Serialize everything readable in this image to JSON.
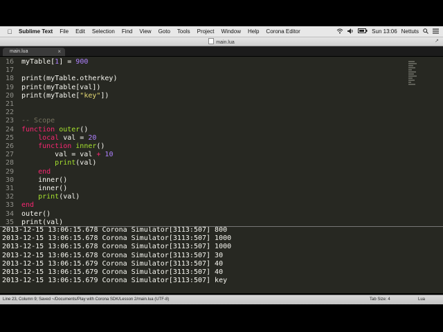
{
  "menubar": {
    "items": [
      "Sublime Text",
      "File",
      "Edit",
      "Selection",
      "Find",
      "View",
      "Goto",
      "Tools",
      "Project",
      "Window",
      "Help",
      "Corona Editor"
    ],
    "clock": "Sun 13:06",
    "user": "Nettuts"
  },
  "window": {
    "title": "main.lua"
  },
  "tab": {
    "label": "main.lua"
  },
  "editor": {
    "lines": [
      {
        "num": "16",
        "tokens": [
          {
            "t": "myTable[",
            "c": "n"
          },
          {
            "t": "1",
            "c": "num"
          },
          {
            "t": "] = ",
            "c": "n"
          },
          {
            "t": "900",
            "c": "num"
          }
        ]
      },
      {
        "num": "17",
        "tokens": []
      },
      {
        "num": "18",
        "tokens": [
          {
            "t": "print(myTable.otherkey)",
            "c": "n"
          }
        ]
      },
      {
        "num": "19",
        "tokens": [
          {
            "t": "print(myTable[val])",
            "c": "n"
          }
        ]
      },
      {
        "num": "20",
        "tokens": [
          {
            "t": "print(myTable[",
            "c": "n"
          },
          {
            "t": "\"key\"",
            "c": "s"
          },
          {
            "t": "])",
            "c": "n"
          }
        ]
      },
      {
        "num": "21",
        "tokens": []
      },
      {
        "num": "22",
        "tokens": []
      },
      {
        "num": "23",
        "tokens": [
          {
            "t": "-- Scope",
            "c": "c"
          }
        ]
      },
      {
        "num": "24",
        "tokens": [
          {
            "t": "function ",
            "c": "k"
          },
          {
            "t": "outer",
            "c": "f"
          },
          {
            "t": "()",
            "c": "n"
          }
        ]
      },
      {
        "num": "25",
        "tokens": [
          {
            "t": "    ",
            "c": "n"
          },
          {
            "t": "local ",
            "c": "k"
          },
          {
            "t": "val = ",
            "c": "n"
          },
          {
            "t": "20",
            "c": "num"
          }
        ]
      },
      {
        "num": "26",
        "tokens": [
          {
            "t": "    ",
            "c": "n"
          },
          {
            "t": "function ",
            "c": "k"
          },
          {
            "t": "inner",
            "c": "f"
          },
          {
            "t": "()",
            "c": "n"
          }
        ]
      },
      {
        "num": "27",
        "tokens": [
          {
            "t": "        val = val ",
            "c": "n"
          },
          {
            "t": "+ ",
            "c": "k"
          },
          {
            "t": "10",
            "c": "num"
          }
        ]
      },
      {
        "num": "28",
        "tokens": [
          {
            "t": "        ",
            "c": "n"
          },
          {
            "t": "print",
            "c": "f"
          },
          {
            "t": "(val)",
            "c": "n"
          }
        ]
      },
      {
        "num": "29",
        "tokens": [
          {
            "t": "    ",
            "c": "n"
          },
          {
            "t": "end",
            "c": "k"
          }
        ]
      },
      {
        "num": "30",
        "tokens": [
          {
            "t": "    inner()",
            "c": "n"
          }
        ]
      },
      {
        "num": "31",
        "tokens": [
          {
            "t": "    inner()",
            "c": "n"
          }
        ]
      },
      {
        "num": "32",
        "tokens": [
          {
            "t": "    ",
            "c": "n"
          },
          {
            "t": "print",
            "c": "f"
          },
          {
            "t": "(val)",
            "c": "n"
          }
        ]
      },
      {
        "num": "33",
        "tokens": [
          {
            "t": "end",
            "c": "k"
          }
        ]
      },
      {
        "num": "34",
        "tokens": [
          {
            "t": "outer()",
            "c": "n"
          }
        ]
      },
      {
        "num": "35",
        "tokens": [
          {
            "t": "print(val)",
            "c": "n"
          }
        ]
      }
    ]
  },
  "console": {
    "lines": [
      "2013-12-15 13:06:15.678 Corona Simulator[3113:507] 800",
      "2013-12-15 13:06:15.678 Corona Simulator[3113:507] 1000",
      "2013-12-15 13:06:15.678 Corona Simulator[3113:507] 1000",
      "2013-12-15 13:06:15.678 Corona Simulator[3113:507] 30",
      "2013-12-15 13:06:15.679 Corona Simulator[3113:507] 40",
      "2013-12-15 13:06:15.679 Corona Simulator[3113:507] 40",
      "2013-12-15 13:06:15.679 Corona Simulator[3113:507] key"
    ]
  },
  "statusbar": {
    "left": "Line 23, Column 9; Saved ~/Documents/Play with Corona SDK/Lesson 2/main.lua (UTF-8)",
    "tab_size": "Tab Size: 4",
    "syntax": "Lua"
  },
  "colors": {
    "editor_bg": "#272822",
    "keyword": "#f92672",
    "function": "#a6e22e",
    "number": "#ae81ff",
    "string": "#e6db74",
    "comment": "#75715e"
  }
}
